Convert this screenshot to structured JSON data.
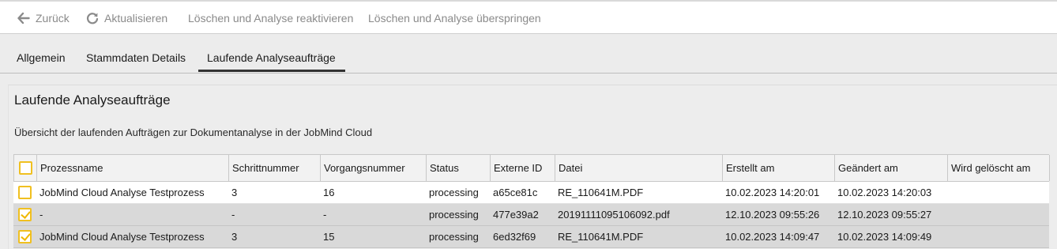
{
  "toolbar": {
    "back_label": "Zurück",
    "refresh_label": "Aktualisieren",
    "reactivate_label": "Löschen und Analyse reaktivieren",
    "skip_label": "Löschen und Analyse überspringen"
  },
  "tabs": [
    {
      "label": "Allgemein"
    },
    {
      "label": "Stammdaten Details"
    },
    {
      "label": "Laufende Analyseaufträge",
      "active": true
    }
  ],
  "panel": {
    "title": "Laufende Analyseaufträge",
    "description": "Übersicht der laufenden Aufträgen zur Dokumentanalyse in der JobMind Cloud"
  },
  "table": {
    "columns": [
      "Prozessname",
      "Schrittnummer",
      "Vorgangsnummer",
      "Status",
      "Externe ID",
      "Datei",
      "Erstellt am",
      "Geändert am",
      "Wird gelöscht am"
    ],
    "rows": [
      {
        "checked": false,
        "cells": [
          "JobMind Cloud Analyse Testprozess",
          "3",
          "16",
          "processing",
          "a65ce81c",
          "RE_110641M.PDF",
          "10.02.2023 14:20:01",
          "10.02.2023 14:20:03",
          ""
        ]
      },
      {
        "checked": true,
        "cells": [
          "-",
          "-",
          "-",
          "processing",
          "477e39a2",
          "20191111095106092.pdf",
          "12.10.2023 09:55:26",
          "12.10.2023 09:55:27",
          ""
        ]
      },
      {
        "checked": true,
        "cells": [
          "JobMind Cloud Analyse Testprozess",
          "3",
          "15",
          "processing",
          "6ed32f69",
          "RE_110641M.PDF",
          "10.02.2023 14:09:47",
          "10.02.2023 14:09:49",
          ""
        ]
      }
    ]
  },
  "colors": {
    "checkbox_border": "#f0c020",
    "selected_row": "#d9d9d9",
    "toolbar_text": "#8a8a8a"
  }
}
